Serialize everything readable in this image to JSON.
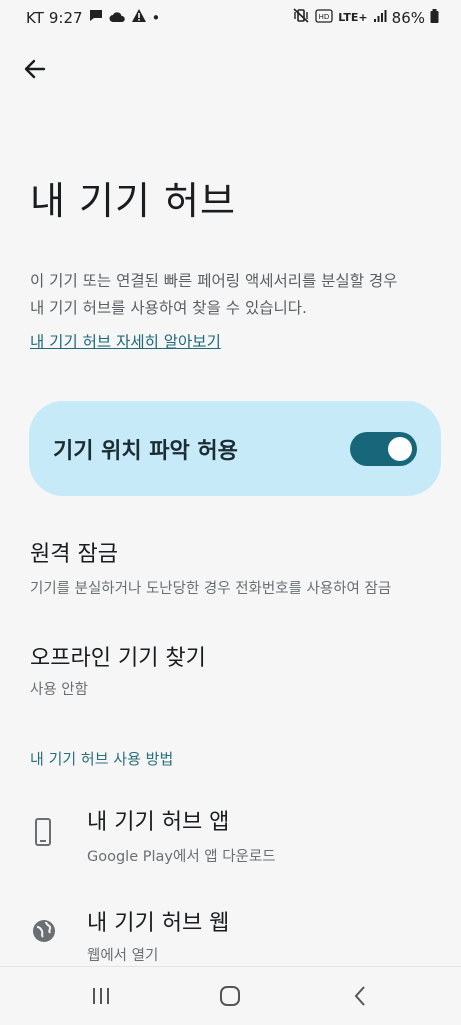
{
  "status_bar": {
    "carrier": "KT",
    "time": "9:27",
    "dot": "•",
    "network": "LTE+",
    "battery": "86%"
  },
  "header": {
    "title": "내 기기 허브"
  },
  "description": {
    "line1": "이 기기 또는 연결된 빠른 페어링 액세서리를 분실할 경우",
    "line2": "내 기기 허브를 사용하여 찾을 수 있습니다.",
    "learn_more": "내 기기 허브 자세히 알아보기"
  },
  "location_card": {
    "label": "기기 위치 파악 허용",
    "enabled": true
  },
  "settings": [
    {
      "title": "원격 잠금",
      "subtitle": "기기를 분실하거나 도난당한 경우 전화번호를 사용하여 잠금"
    },
    {
      "title": "오프라인 기기 찾기",
      "subtitle": "사용 안함"
    }
  ],
  "section_header": "내 기기 허브 사용 방법",
  "ways": [
    {
      "icon": "phone-icon",
      "title": "내 기기 허브 앱",
      "subtitle": "Google Play에서 앱 다운로드"
    },
    {
      "icon": "globe-icon",
      "title": "내 기기 허브 웹",
      "subtitle": "웹에서 열기"
    }
  ],
  "colors": {
    "accent": "#18667a",
    "card": "#c7eaf8",
    "link": "#1e6b78"
  }
}
